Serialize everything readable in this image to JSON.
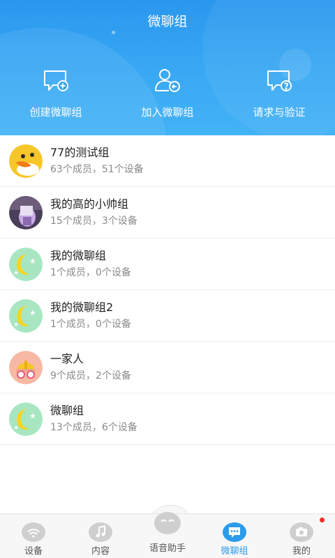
{
  "header": {
    "title": "微聊组",
    "actions": [
      {
        "label": "创建微聊组",
        "icon": "chat-plus-icon"
      },
      {
        "label": "加入微聊组",
        "icon": "user-join-icon"
      },
      {
        "label": "请求与验证",
        "icon": "chat-question-icon"
      }
    ]
  },
  "groups": [
    {
      "name": "77的测试组",
      "sub": "63个成员，51个设备",
      "avatar": "duck-avatar"
    },
    {
      "name": "我的高的小帅组",
      "sub": "15个成员，3个设备",
      "avatar": "photo-avatar"
    },
    {
      "name": "我的微聊组",
      "sub": "1个成员，0个设备",
      "avatar": "moon-avatar"
    },
    {
      "name": "我的微聊组2",
      "sub": "1个成员，0个设备",
      "avatar": "moon-avatar"
    },
    {
      "name": "一家人",
      "sub": "9个成员，2个设备",
      "avatar": "car-avatar"
    },
    {
      "name": "微聊组",
      "sub": "13个成员，6个设备",
      "avatar": "moon-avatar"
    }
  ],
  "nav": {
    "items": [
      {
        "label": "设备",
        "icon": "device-icon"
      },
      {
        "label": "内容",
        "icon": "music-icon"
      },
      {
        "label": "语音助手",
        "icon": "voice-assistant-icon"
      },
      {
        "label": "微聊组",
        "icon": "chat-icon",
        "active": true
      },
      {
        "label": "我的",
        "icon": "profile-icon",
        "badge": true
      }
    ]
  },
  "colors": {
    "header_top": "#2a97ee",
    "header_bottom": "#43b2f6",
    "accent": "#2c9bea",
    "badge": "#f02b2b"
  }
}
